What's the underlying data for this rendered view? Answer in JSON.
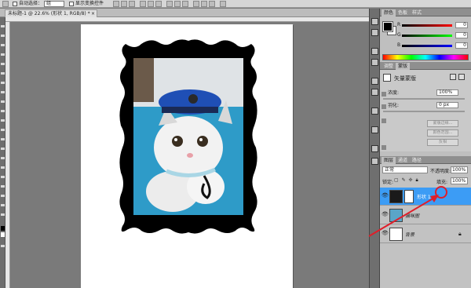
{
  "options_bar": {
    "auto_select_label": "自动选择：",
    "auto_select_value": "组",
    "show_transform_label": "显示变换控件"
  },
  "document": {
    "tab_title": "未标题-1 @ 22.6% (形状 1, RGB/8) *",
    "close_icon": "close-icon"
  },
  "color_panel": {
    "tabs": [
      "颜色",
      "色板",
      "样式"
    ],
    "channels": [
      {
        "label": "R",
        "value": "0",
        "color": "#ff0000"
      },
      {
        "label": "G",
        "value": "0",
        "color": "#00ff00"
      },
      {
        "label": "B",
        "value": "0",
        "color": "#0000ff"
      }
    ],
    "foreground_color": "#000000",
    "background_color": "#ffffff"
  },
  "mask_panel": {
    "tabs": [
      "调整",
      "蒙版"
    ],
    "title": "矢量蒙版",
    "density_label": "浓度:",
    "density_value": "100%",
    "feather_label": "羽化:",
    "feather_value": "0 px",
    "mask_edge_label": "蒙版边缘...",
    "color_range_label": "颜色范围...",
    "invert_label": "反相"
  },
  "layers_panel": {
    "tabs": [
      "图层",
      "通道",
      "路径"
    ],
    "blend_mode": "正常",
    "opacity_label": "不透明度:",
    "opacity_value": "100%",
    "lock_label": "锁定:",
    "fill_label": "填充:",
    "fill_value": "100%",
    "layers": [
      {
        "name": "形状 1",
        "selected": true,
        "thumb_color": "#1a1a1a"
      },
      {
        "name": "猫咪图",
        "selected": false,
        "thumb_color": "#5aa5c8"
      },
      {
        "name": "背景",
        "selected": false,
        "thumb_color": "#ffffff"
      }
    ]
  },
  "canvas": {
    "background": "#ffffff",
    "frame_color": "#000000",
    "photo_sky": "#2e9bc8",
    "cat_color": "#f2f2f2",
    "hat_color": "#1f4fb5"
  },
  "annotation": {
    "arrow_color": "#e01e2a"
  }
}
